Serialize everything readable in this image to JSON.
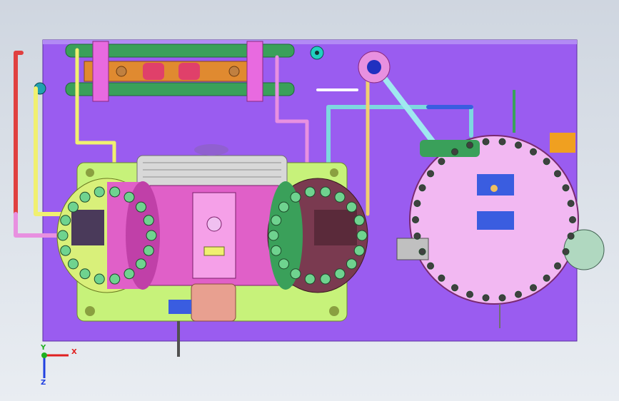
{
  "viewport": {
    "background_top": "#cfd6e0",
    "background_bottom": "#e9edf2"
  },
  "model": {
    "baseplate_color": "#9a5cf0",
    "skid_color": "#c7f27a",
    "vessel_color": "#f2b8f2",
    "cylinder_left_color": "#d9f07a",
    "cylinder_right_color": "#7a3a50",
    "bolt_color": "#6fd38f",
    "pipe_colors": [
      "#7dd8e0",
      "#e890e0",
      "#f0f070",
      "#2f8f4f",
      "#3a5de0"
    ],
    "heat_exchanger_color": "#40a860",
    "manifold_color": "#e08a30"
  },
  "triad": {
    "x_label": "X",
    "y_label": "Y",
    "z_label": "Z",
    "x_color": "#e02020",
    "y_color": "#20b020",
    "z_color": "#2040e0"
  }
}
